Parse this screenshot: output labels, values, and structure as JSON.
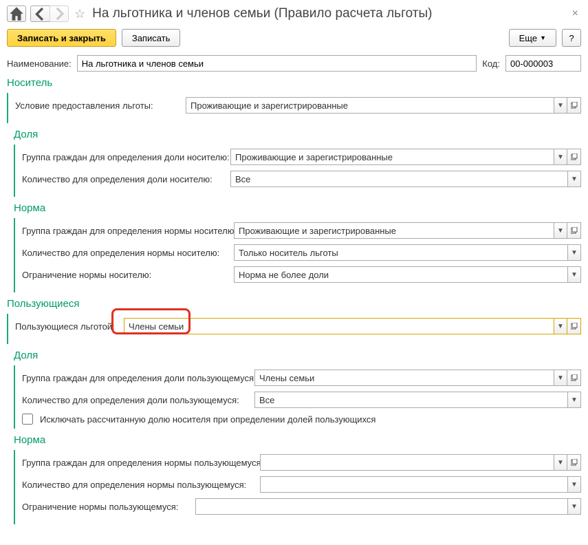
{
  "header": {
    "title": "На льготника и членов семьи (Правило расчета льготы)"
  },
  "toolbar": {
    "save_close": "Записать и закрыть",
    "save": "Записать",
    "more": "Еще",
    "help": "?"
  },
  "main": {
    "name_label": "Наименование:",
    "name_value": "На льготника и членов семьи",
    "code_label": "Код:",
    "code_value": "00-000003"
  },
  "nositel": {
    "title": "Носитель",
    "uslovie_label": "Условие предоставления льготы:",
    "uslovie_value": "Проживающие и зарегистрированные",
    "dolya_title": "Доля",
    "dolya_group_label": "Группа граждан для определения доли носителю:",
    "dolya_group_value": "Проживающие и зарегистрированные",
    "dolya_count_label": "Количество для определения доли носителю:",
    "dolya_count_value": "Все",
    "norma_title": "Норма",
    "norma_group_label": "Группа граждан для определения нормы носителю:",
    "norma_group_value": "Проживающие и зарегистрированные",
    "norma_count_label": "Количество для определения нормы носителю:",
    "norma_count_value": "Только носитель льготы",
    "norma_limit_label": "Ограничение нормы носителю:",
    "norma_limit_value": "Норма не более доли"
  },
  "polz": {
    "title": "Пользующиеся",
    "lgota_label": "Пользующиеся льготой:",
    "lgota_value": "Члены семьи",
    "dolya_title": "Доля",
    "dolya_group_label": "Группа граждан для определения доли пользующемуся:",
    "dolya_group_value": "Члены семьи",
    "dolya_count_label": "Количество для определения доли пользующемуся:",
    "dolya_count_value": "Все",
    "exclude_label": "Исключать рассчитанную долю носителя при определении долей пользующихся",
    "norma_title": "Норма",
    "norma_group_label": "Группа граждан для определения нормы пользующемуся:",
    "norma_group_value": "",
    "norma_count_label": "Количество для определения нормы пользующемуся:",
    "norma_count_value": "",
    "norma_limit_label": "Ограничение нормы пользующемуся:",
    "norma_limit_value": ""
  }
}
